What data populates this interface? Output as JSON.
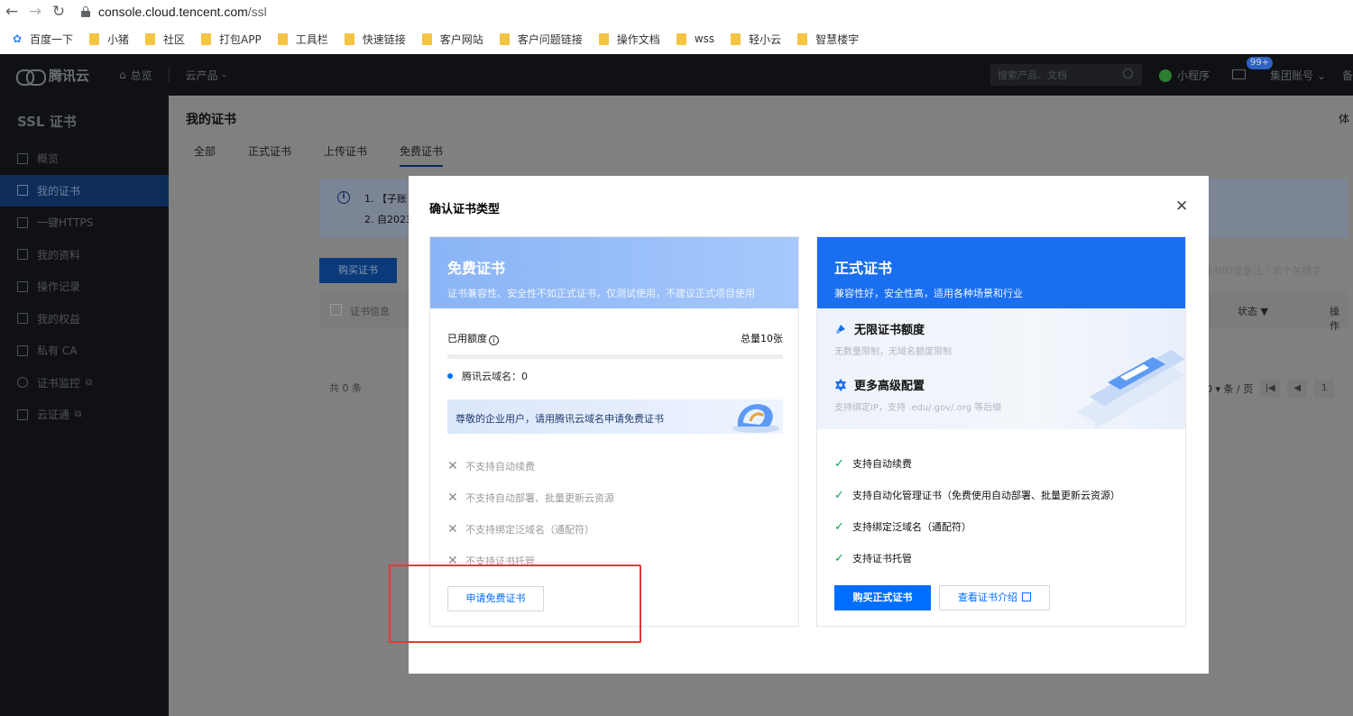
{
  "browser": {
    "url_domain": "console.cloud.tencent.com",
    "url_path": "/ssl",
    "back_icon": "arrow-left-icon",
    "forward_icon": "arrow-right-icon",
    "reload_icon": "reload-icon",
    "bookmarks": [
      "百度一下",
      "小猪",
      "社区",
      "打包APP",
      "工具栏",
      "快速链接",
      "客户网站",
      "客户问题链接",
      "操作文档",
      "wss",
      "轻小云",
      "智慧楼宇"
    ]
  },
  "topnav": {
    "brand": "腾讯云",
    "overview": "总览",
    "products": "云产品",
    "search_placeholder": "搜索产品、文档",
    "mini_program": "小程序",
    "badge": "99+",
    "account": "集团账号",
    "edge": "备"
  },
  "sidebar": {
    "title": "SSL 证书",
    "items": [
      {
        "label": "概览",
        "icon": "grid-icon"
      },
      {
        "label": "我的证书",
        "icon": "certificate-icon"
      },
      {
        "label": "一键HTTPS",
        "icon": "https-icon"
      },
      {
        "label": "我的资料",
        "icon": "folder-icon"
      },
      {
        "label": "操作记录",
        "icon": "record-icon"
      },
      {
        "label": "我的权益",
        "icon": "gift-icon"
      },
      {
        "label": "私有 CA",
        "icon": "ca-icon"
      },
      {
        "label": "证书监控",
        "icon": "monitor-icon"
      },
      {
        "label": "云证通",
        "icon": "shield-icon"
      }
    ]
  },
  "main": {
    "title": "我的证书",
    "right_edge": "体",
    "tabs": [
      "全部",
      "正式证书",
      "上传证书",
      "免费证书"
    ],
    "notice_line1": "1. 【子账",
    "notice_line2": "2. 自2023",
    "buy_button": "购买证书",
    "search_placeholder": "证书ID或备注 / 单个关键字",
    "col_info": "证书信息",
    "col_status": "状态",
    "col_action": "操作",
    "total": "共 0 条",
    "page_size": "0 ▾ 条 / 页",
    "page_first": "|◀",
    "page_prev": "◀",
    "page_num": "1"
  },
  "modal": {
    "title": "确认证书类型",
    "close_icon": "close-icon",
    "free": {
      "title": "免费证书",
      "subtitle": "证书兼容性、安全性不如正式证书，仅测试使用，不建议正式项目使用",
      "quota_label": "已用额度",
      "quota_total": "总量10张",
      "quota_used_fraction": 0,
      "domain_label": "腾讯云域名：0",
      "banner": "尊敬的企业用户，请用腾讯云域名申请免费证书",
      "features": [
        "不支持自动续费",
        "不支持自动部署、批量更新云资源",
        "不支持绑定泛域名（通配符）",
        "不支持证书托管"
      ],
      "apply_button": "申请免费证书"
    },
    "paid": {
      "title": "正式证书",
      "subtitle": "兼容性好，安全性高，适用各种场景和行业",
      "perk1_title": "无限证书额度",
      "perk1_desc": "无数量限制，无域名额度限制",
      "perk2_title": "更多高级配置",
      "perk2_desc": "支持绑定IP，支持 .edu/.gov/.org 等后缀",
      "features": [
        "支持自动续费",
        "支持自动化管理证书（免费使用自动部署、批量更新云资源）",
        "支持绑定泛域名（通配符）",
        "支持证书托管"
      ],
      "buy_button": "购买正式证书",
      "intro_button": "查看证书介绍"
    }
  },
  "colors": {
    "primary": "#006eff",
    "highlight": "#e53935",
    "check": "#10a854"
  }
}
